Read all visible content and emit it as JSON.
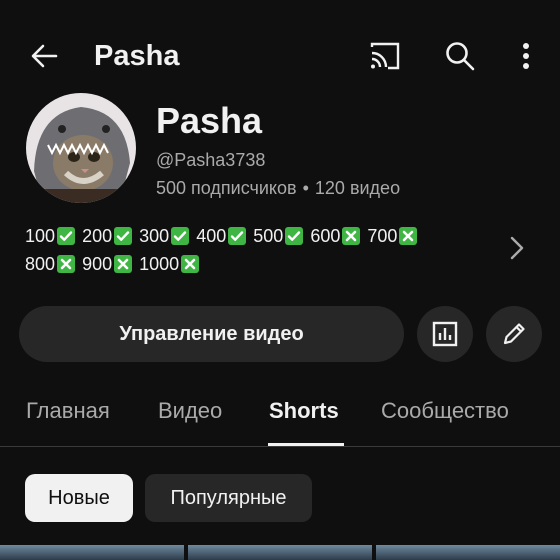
{
  "header": {
    "title": "Pasha"
  },
  "profile": {
    "name": "Pasha",
    "handle": "@Pasha3738",
    "subscribers": "500 подписчиков",
    "separator": "•",
    "videos": "120 видео",
    "description": {
      "line1": [
        {
          "text": "100",
          "mark": "check"
        },
        {
          "text": "200",
          "mark": "check"
        },
        {
          "text": "300",
          "mark": "check"
        },
        {
          "text": "400",
          "mark": "check"
        },
        {
          "text": "500",
          "mark": "check"
        },
        {
          "text": "600",
          "mark": "cross"
        },
        {
          "text": "700",
          "mark": "cross"
        }
      ],
      "line2": [
        {
          "text": "800",
          "mark": "cross"
        },
        {
          "text": "900",
          "mark": "cross"
        },
        {
          "text": "1000",
          "mark": "cross"
        }
      ]
    }
  },
  "actions": {
    "manage_label": "Управление видео"
  },
  "tabs": [
    {
      "label": "Главная",
      "active": false
    },
    {
      "label": "Видео",
      "active": false
    },
    {
      "label": "Shorts",
      "active": true
    },
    {
      "label": "Сообщество",
      "active": false
    }
  ],
  "chips": [
    {
      "label": "Новые",
      "selected": true
    },
    {
      "label": "Популярные",
      "selected": false
    }
  ],
  "colors": {
    "background": "#0f0f0f",
    "surface": "#272727",
    "text": "#f1f1f1",
    "secondary_text": "#aaaaaa",
    "check_green": "#3fb543"
  },
  "icons": {
    "back": "arrow-left-icon",
    "cast": "cast-icon",
    "search": "search-icon",
    "more": "more-vert-icon",
    "analytics": "analytics-icon",
    "edit": "pencil-icon",
    "expand": "chevron-right-icon"
  }
}
